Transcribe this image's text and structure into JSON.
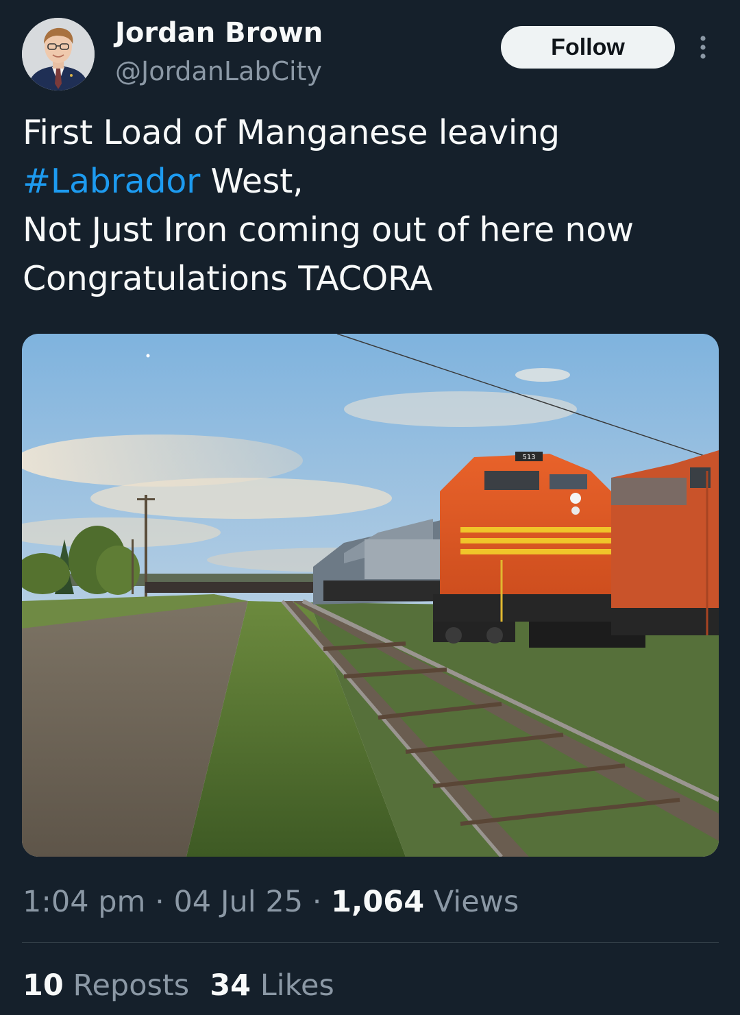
{
  "author": {
    "name": "Jordan Brown",
    "handle": "@JordanLabCity"
  },
  "follow_label": "Follow",
  "tweet": {
    "line1": "First Load of Manganese leaving",
    "hashtag": "#Labrador",
    "line2_rest": " West,",
    "line3": "Not Just Iron coming out of here now",
    "line4": "Congratulations TACORA"
  },
  "meta": {
    "time": "1:04 pm",
    "sep": " · ",
    "date": "04 Jul 25",
    "views_count": "1,064",
    "views_label": " Views"
  },
  "stats": {
    "reposts_count": "10",
    "reposts_label": " Reposts",
    "likes_count": "34",
    "likes_label": " Likes"
  },
  "photo": {
    "locomotive_number": "513"
  },
  "colors": {
    "background": "#15202b",
    "link": "#1d9bf0",
    "secondary_text": "#8b98a5"
  },
  "icons": [
    "more-options-icon"
  ]
}
